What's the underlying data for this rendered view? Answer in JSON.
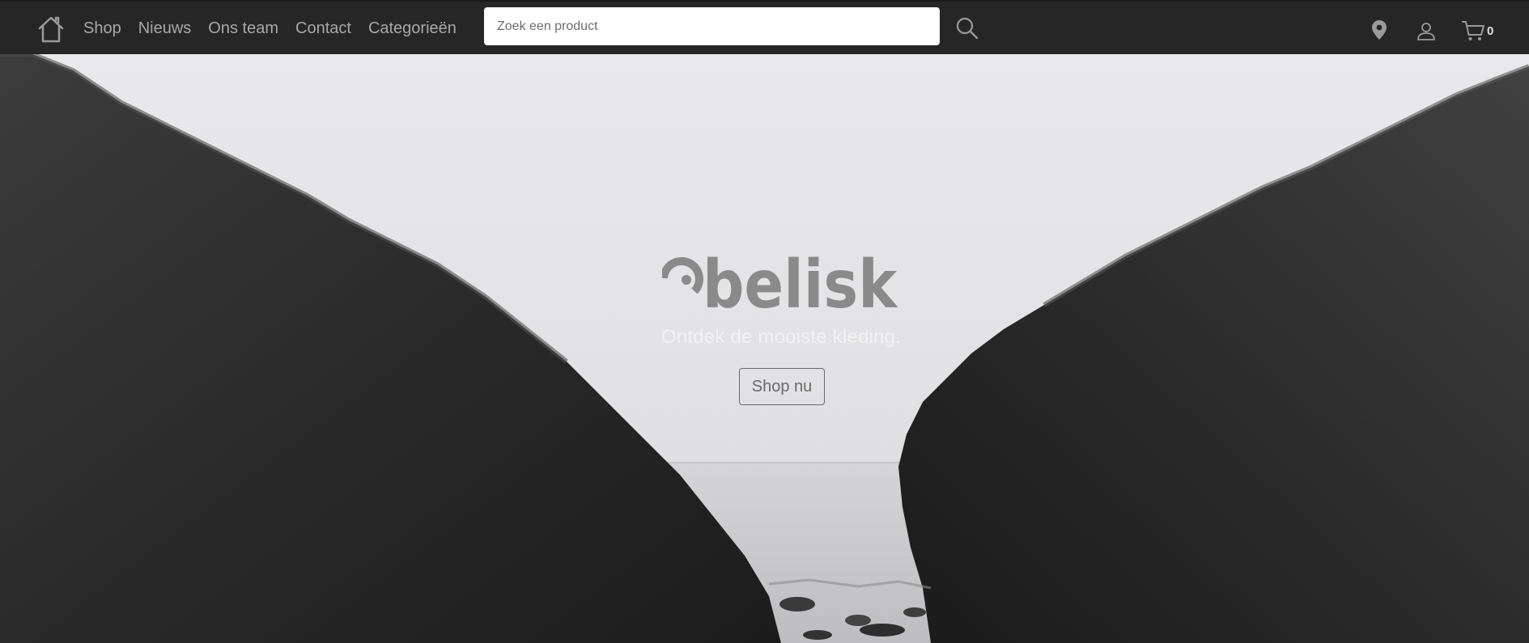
{
  "nav": {
    "home_icon": "home-icon",
    "links": [
      {
        "label": "Shop"
      },
      {
        "label": "Nieuws"
      },
      {
        "label": "Ons team"
      },
      {
        "label": "Contact"
      },
      {
        "label": "Categorieën"
      }
    ]
  },
  "search": {
    "placeholder": "Zoek een product",
    "value": "",
    "icon": "search-icon"
  },
  "actions": {
    "location_icon": "map-pin-icon",
    "user_icon": "user-icon",
    "cart_icon": "shopping-cart-icon",
    "cart_count": "0"
  },
  "hero": {
    "brand": "obelisk",
    "tagline": "Ontdek de mooiste kleding.",
    "cta_label": "Shop nu"
  },
  "colors": {
    "navbar_bg": "#262626",
    "nav_text": "#a8a8a8",
    "logo_gray": "#8a8a8a",
    "cta_border": "#6a6a6a"
  }
}
